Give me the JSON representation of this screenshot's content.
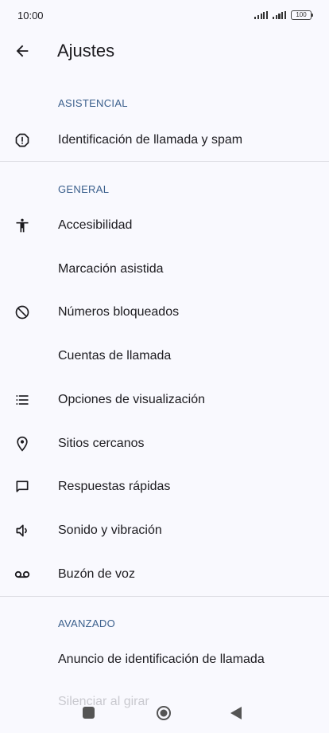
{
  "status_bar": {
    "time": "10:00",
    "battery": "100"
  },
  "app_bar": {
    "title": "Ajustes"
  },
  "sections": {
    "asistencial": "ASISTENCIAL",
    "general": "GENERAL",
    "avanzado": "AVANZADO"
  },
  "items": {
    "caller_id": "Identificación de llamada y spam",
    "accessibility": "Accesibilidad",
    "assisted_dialing": "Marcación asistida",
    "blocked_numbers": "Números bloqueados",
    "calling_accounts": "Cuentas de llamada",
    "display_options": "Opciones de visualización",
    "nearby_places": "Sitios cercanos",
    "quick_responses": "Respuestas rápidas",
    "sound_vibration": "Sonido y vibración",
    "voicemail": "Buzón de voz",
    "caller_id_announce": "Anuncio de identificación de llamada",
    "flip_to_silence": "Silenciar al girar"
  },
  "icons": {
    "back": "arrow-left-icon",
    "caller_id": "alert-octagon-icon",
    "accessibility": "accessibility-person-icon",
    "blocked": "block-icon",
    "display": "list-icon",
    "nearby": "location-pin-icon",
    "quick_responses": "chat-bubble-icon",
    "sound": "speaker-icon",
    "voicemail": "voicemail-icon"
  },
  "colors": {
    "background": "#f9f9fe",
    "section_header": "#3a5f8c",
    "text": "#1c1b1f"
  }
}
